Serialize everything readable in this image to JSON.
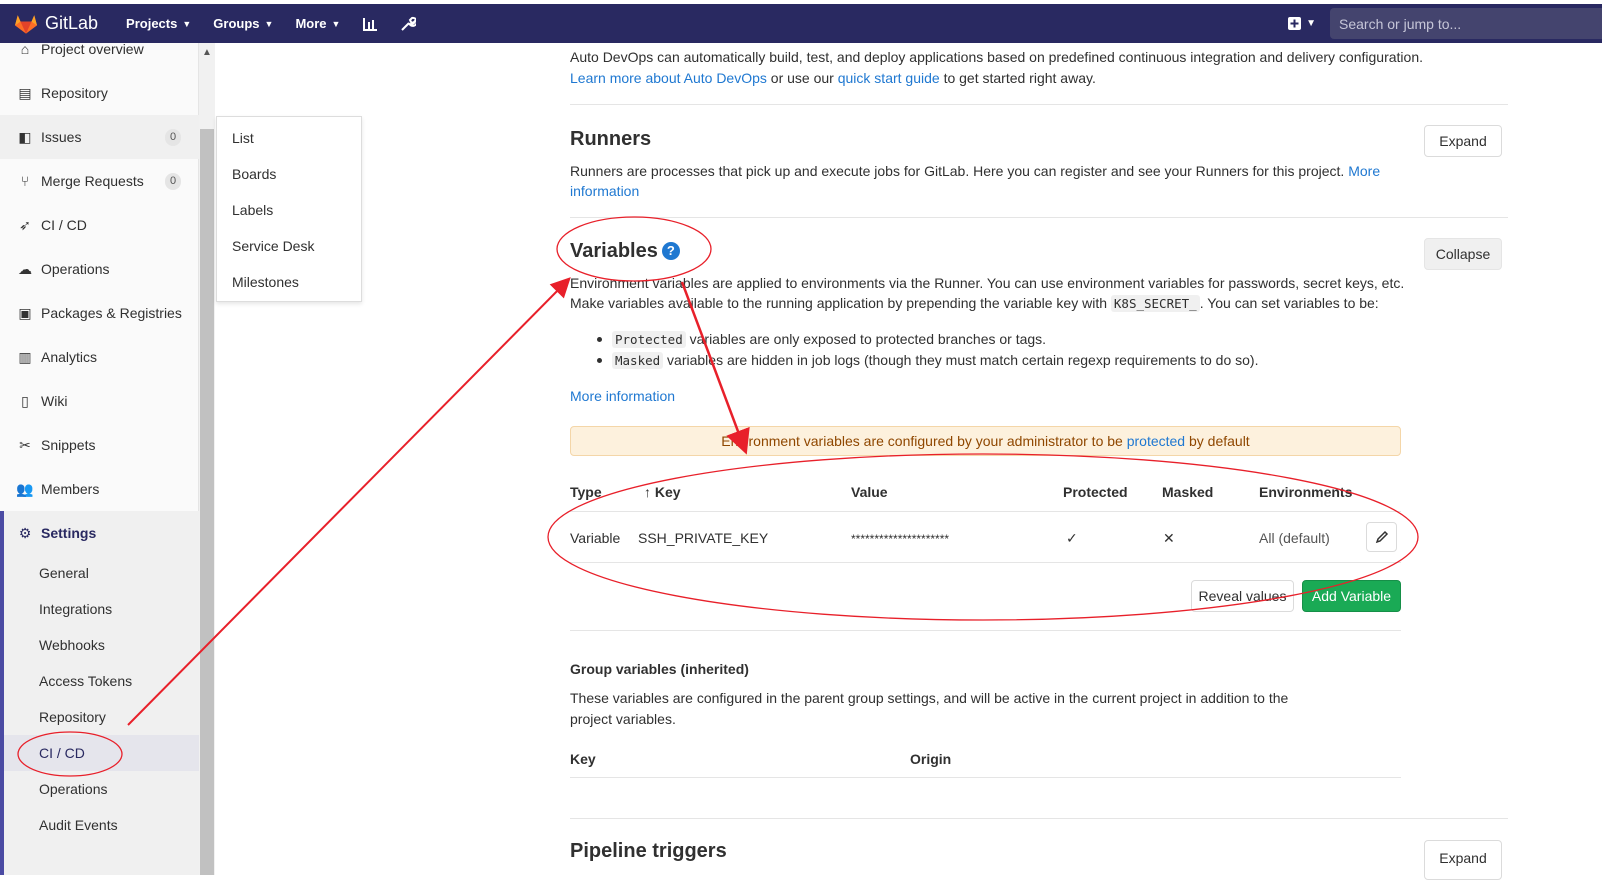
{
  "topbar": {
    "brand": "GitLab",
    "nav": [
      "Projects",
      "Groups",
      "More"
    ],
    "search_placeholder": "Search or jump to..."
  },
  "sidebar": {
    "items": [
      {
        "label": "Project overview",
        "icon": "home-icon"
      },
      {
        "label": "Repository",
        "icon": "doc-icon"
      },
      {
        "label": "Issues",
        "icon": "issues-icon",
        "count": "0"
      },
      {
        "label": "Merge Requests",
        "icon": "merge-icon",
        "count": "0"
      },
      {
        "label": "CI / CD",
        "icon": "rocket-icon"
      },
      {
        "label": "Operations",
        "icon": "cloud-icon"
      },
      {
        "label": "Packages & Registries",
        "icon": "package-icon"
      },
      {
        "label": "Analytics",
        "icon": "chart-icon"
      },
      {
        "label": "Wiki",
        "icon": "book-icon"
      },
      {
        "label": "Snippets",
        "icon": "scissors-icon"
      },
      {
        "label": "Members",
        "icon": "users-icon"
      },
      {
        "label": "Settings",
        "icon": "gear-icon"
      }
    ],
    "settings_sub": [
      "General",
      "Integrations",
      "Webhooks",
      "Access Tokens",
      "Repository",
      "CI / CD",
      "Operations",
      "Audit Events"
    ]
  },
  "flyout": [
    "List",
    "Boards",
    "Labels",
    "Service Desk",
    "Milestones"
  ],
  "autodevops": {
    "line1": "Auto DevOps can automatically build, test, and deploy applications based on predefined continuous integration and delivery configuration.",
    "link1": "Learn more about Auto DevOps",
    "mid": " or use our ",
    "link2": "quick start guide",
    "tail": " to get started right away."
  },
  "runners": {
    "title": "Runners",
    "desc": "Runners are processes that pick up and execute jobs for GitLab. Here you can register and see your Runners for this project.",
    "more": "More",
    "information": "information",
    "button": "Expand"
  },
  "variables": {
    "title": "Variables",
    "help": "?",
    "button": "Collapse",
    "desc1": "Environment variables are applied to environments via the Runner. You can use environment variables for passwords, secret keys, etc.",
    "desc2a": "Make variables available to the running application by prepending the variable key with ",
    "desc2code": "K8S_SECRET_",
    "desc2b": ". You can set variables to be:",
    "bullet1_code": "Protected",
    "bullet1_text": " variables are only exposed to protected branches or tags.",
    "bullet2_code": "Masked",
    "bullet2_text": " variables are hidden in job logs (though they must match certain regexp requirements to do so).",
    "more_info": "More information",
    "alert_a": "Environment variables are configured by your administrator to be ",
    "alert_link": "protected",
    "alert_b": " by default",
    "table": {
      "headers": [
        "Type",
        "Key",
        "Value",
        "Protected",
        "Masked",
        "Environments"
      ],
      "row": {
        "type": "Variable",
        "key": "SSH_PRIVATE_KEY",
        "value": "*********************",
        "protected": "✓",
        "masked": "✕",
        "env": "All (default)"
      }
    },
    "reveal": "Reveal values",
    "add": "Add Variable"
  },
  "group_vars": {
    "title": "Group variables (inherited)",
    "desc1": "These variables are configured in the parent group settings, and will be active in the current project in addition to the",
    "desc2": "project variables.",
    "headers": [
      "Key",
      "Origin"
    ]
  },
  "pipeline": {
    "title": "Pipeline triggers",
    "button": "Expand"
  },
  "colors": {
    "nav_bg": "#292961",
    "link": "#1f78d1",
    "success": "#1aaa55",
    "annotation": "#e8202a"
  }
}
